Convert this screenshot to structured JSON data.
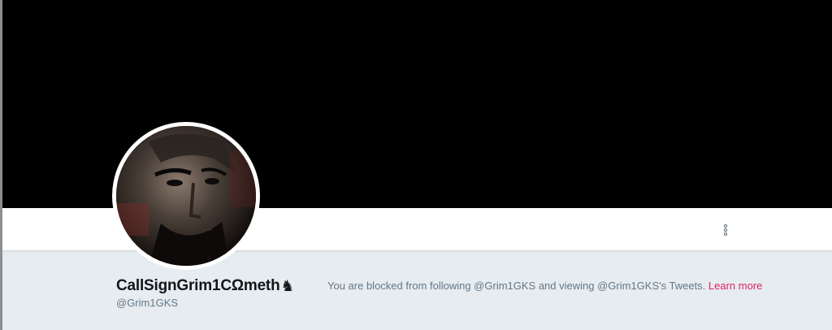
{
  "profile": {
    "display_name": "CallSignGrim1CΩmeth",
    "name_emoji": "♞",
    "handle": "@Grim1GKS"
  },
  "header": {
    "banner_color": "#000000"
  },
  "navbar": {
    "more_icon": "vertical-ellipsis-icon"
  },
  "notice": {
    "text": "You are blocked from following @Grim1GKS and viewing @Grim1GKS's Tweets.",
    "link_label": "Learn more",
    "link_color": "#e0245e"
  },
  "colors": {
    "background": "#e6ecf0",
    "name": "#14171a",
    "secondary_text": "#657786"
  }
}
